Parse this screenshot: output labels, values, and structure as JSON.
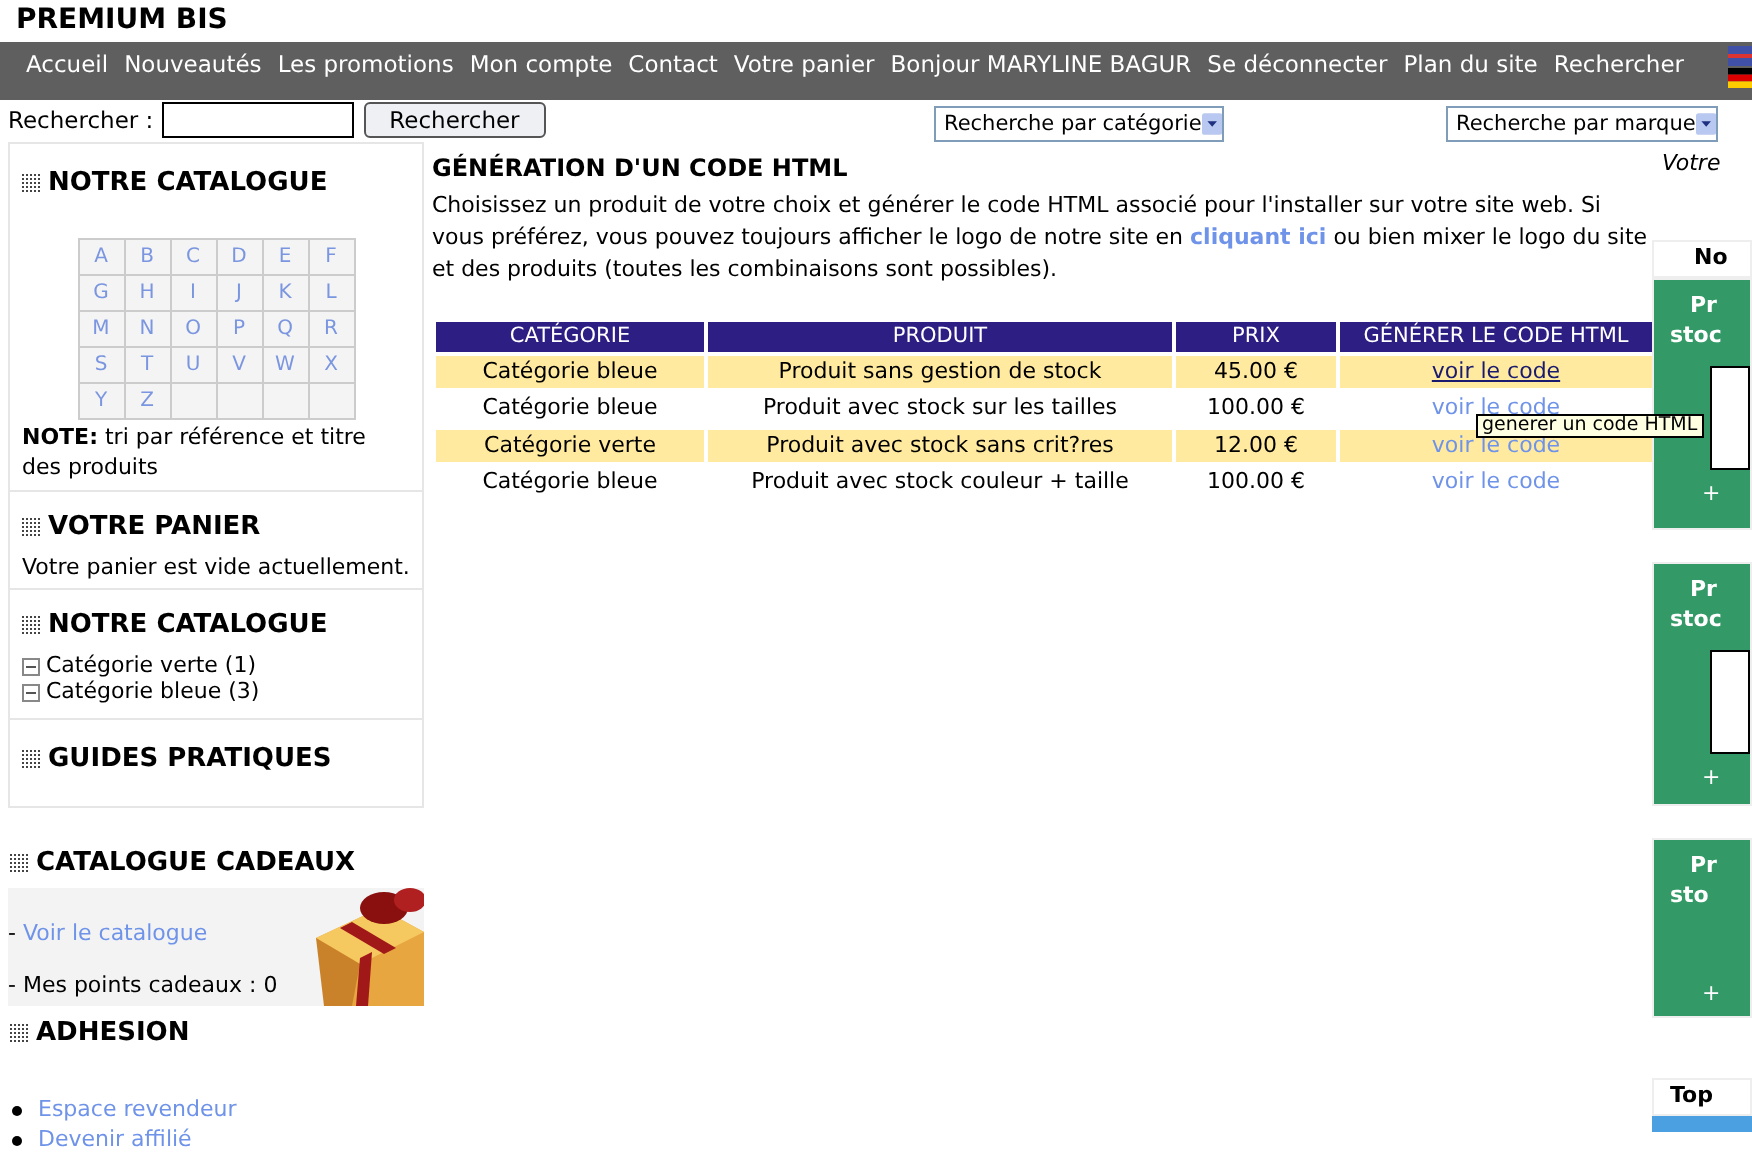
{
  "site_title": "PREMIUM BIS",
  "nav": [
    "Accueil",
    "Nouveautés",
    "Les promotions",
    "Mon compte",
    "Contact",
    "Votre panier",
    "Bonjour MARYLINE BAGUR",
    "Se déconnecter",
    "Plan du site",
    "Rechercher"
  ],
  "search": {
    "label": "Rechercher :",
    "button": "Rechercher",
    "category_select": "Recherche par catégorie",
    "brand_select": "Recherche par marque"
  },
  "sidebar": {
    "catalogue": {
      "title": "NOTRE CATALOGUE",
      "letters": [
        "A",
        "B",
        "C",
        "D",
        "E",
        "F",
        "G",
        "H",
        "I",
        "J",
        "K",
        "L",
        "M",
        "N",
        "O",
        "P",
        "Q",
        "R",
        "S",
        "T",
        "U",
        "V",
        "W",
        "X",
        "Y",
        "Z"
      ],
      "note_label": "NOTE:",
      "note": "tri par référence et titre des produits"
    },
    "cart": {
      "title": "VOTRE PANIER",
      "text": "Votre panier est vide actuellement."
    },
    "tree": {
      "title": "NOTRE CATALOGUE",
      "items": [
        {
          "label": "Catégorie verte (1)",
          "expanded": true
        },
        {
          "label": "Catégorie bleue (3)",
          "expanded": true
        }
      ]
    },
    "guides": {
      "title": "GUIDES PRATIQUES"
    },
    "gifts": {
      "title": "CATALOGUE CADEAUX",
      "link_prefix": "- ",
      "link": "Voir le catalogue",
      "points": "- Mes points cadeaux : 0"
    },
    "membership": {
      "title": "ADHESION",
      "links": [
        "Espace revendeur",
        "Devenir affilié"
      ]
    }
  },
  "main": {
    "title": "GÉNÉRATION D'UN CODE HTML",
    "intro": "Choisissez un produit de votre choix et générer le code HTML associé pour l'installer sur votre site web. Si vous préférez, vous pouvez toujours afficher le logo de notre site en **cliquant ici** ou bien mixer le logo du site et des produits (toutes les combinaisons sont possibles).",
    "table": {
      "columns": [
        "CATÉGORIE",
        "PRODUIT",
        "PRIX",
        "GÉNÉRER LE CODE HTML"
      ],
      "rows": [
        {
          "category": "Catégorie bleue",
          "product": "Produit sans gestion de stock",
          "price": "45.00 €",
          "link": "voir le code",
          "hovered": true
        },
        {
          "category": "Catégorie bleue",
          "product": "Produit avec stock sur les tailles",
          "price": "100.00 €",
          "link": "voir le code",
          "hovered": false
        },
        {
          "category": "Catégorie verte",
          "product": "Produit avec stock sans crit?res",
          "price": "12.00 €",
          "link": "voir le code",
          "hovered": false
        },
        {
          "category": "Catégorie bleue",
          "product": "Produit avec stock couleur + taille",
          "price": "100.00 €",
          "link": "voir le code",
          "hovered": false
        }
      ]
    },
    "tooltip": "generer un code HTML"
  },
  "right": {
    "top_text": "Votre",
    "header": "No",
    "cards": [
      {
        "lines": [
          "Pr",
          "stoc"
        ],
        "has_image": true,
        "plus": "+"
      },
      {
        "lines": [
          "Pr",
          "stoc"
        ],
        "has_image": true,
        "plus": "+"
      },
      {
        "lines": [
          "Pr",
          "sto"
        ],
        "has_image": false,
        "plus": "+"
      }
    ],
    "bottom_header": "Top"
  }
}
